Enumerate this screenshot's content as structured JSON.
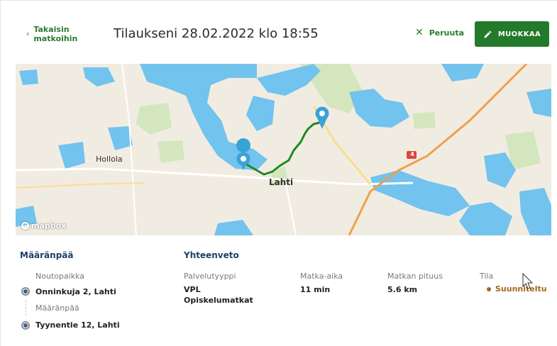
{
  "header": {
    "back_label": "Takaisin matkoihin",
    "title": "Tilaukseni 28.02.2022 klo 18:55",
    "cancel_label": "Peruuta",
    "edit_label": "MUOKKAA"
  },
  "map": {
    "city_label": "Lahti",
    "town_label": "Hollola",
    "road_number": "4",
    "attribution": "mapbox",
    "colors": {
      "water": "#72c3ee",
      "land": "#f1ece2",
      "route": "#1f8a21",
      "marker": "#3aa3d5",
      "highway": "#f0a04a"
    }
  },
  "destination": {
    "heading": "Määränpää",
    "pickup_label": "Noutopaikka",
    "pickup_value": "Onninkuja 2, Lahti",
    "dropoff_label": "Määränpää",
    "dropoff_value": "Tyynentie 12, Lahti"
  },
  "summary": {
    "heading": "Yhteenveto",
    "service_type_label": "Palvelutyyppi",
    "service_type_value": "VPL Opiskelumatkat",
    "duration_label": "Matka-aika",
    "duration_value": "11 min",
    "distance_label": "Matkan pituus",
    "distance_value": "5.6 km",
    "status_label": "Tila",
    "status_value": "Suunniteltu",
    "status_color": "#a06a1a"
  }
}
